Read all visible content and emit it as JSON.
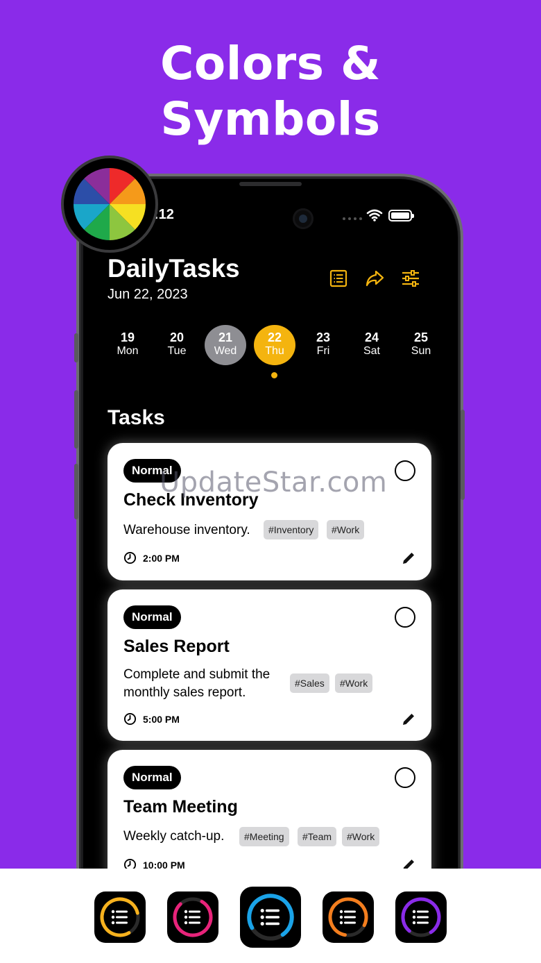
{
  "promo": {
    "headline_line1": "Colors &",
    "headline_line2": "Symbols"
  },
  "status_bar": {
    "time": ":12"
  },
  "header": {
    "title": "DailyTasks",
    "date": "Jun 22, 2023",
    "icons": [
      "list-icon",
      "share-icon",
      "filter-sliders-icon"
    ],
    "accent_color": "#f4b40f"
  },
  "days": [
    {
      "num": "19",
      "dow": "Mon",
      "state": "normal"
    },
    {
      "num": "20",
      "dow": "Tue",
      "state": "normal"
    },
    {
      "num": "21",
      "dow": "Wed",
      "state": "past"
    },
    {
      "num": "22",
      "dow": "Thu",
      "state": "today"
    },
    {
      "num": "23",
      "dow": "Fri",
      "state": "normal"
    },
    {
      "num": "24",
      "dow": "Sat",
      "state": "normal"
    },
    {
      "num": "25",
      "dow": "Sun",
      "state": "normal"
    }
  ],
  "tasks_section": {
    "title": "Tasks"
  },
  "tasks": [
    {
      "priority": "Normal",
      "title": "Check Inventory",
      "description": "Warehouse inventory.",
      "tags": [
        "#Inventory",
        "#Work"
      ],
      "time": "2:00 PM"
    },
    {
      "priority": "Normal",
      "title": "Sales Report",
      "description_line1": "Complete and submit the",
      "description_line2": "monthly sales report.",
      "tags": [
        "#Sales",
        "#Work"
      ],
      "time": "5:00 PM"
    },
    {
      "priority": "Normal",
      "title": "Team Meeting",
      "description": "Weekly catch-up.",
      "tags": [
        "#Meeting",
        "#Team",
        "#Work"
      ],
      "time": "10:00 PM"
    }
  ],
  "watermark": "UpdateStar.com",
  "app_icon_colors": [
    "#f7b21e",
    "#e8237a",
    "#1aa3e8",
    "#f47e1e",
    "#8a2be9"
  ],
  "selected_app_icon": 2
}
